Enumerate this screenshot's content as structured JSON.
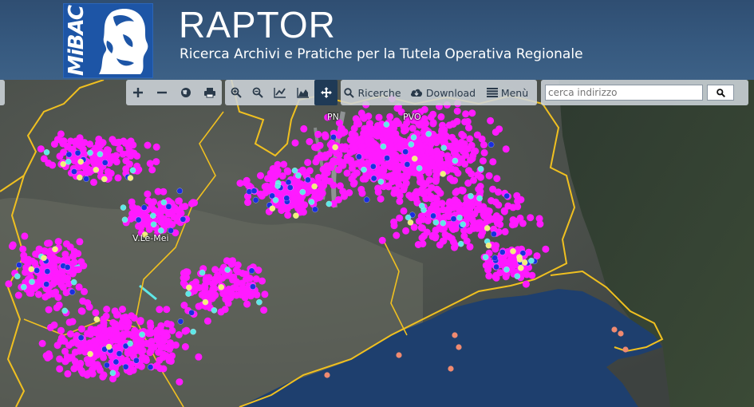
{
  "header": {
    "logo_text": "MiBAC",
    "title": "RAPTOR",
    "subtitle": "Ricerca Archivi e Pratiche per la Tutela Operativa Regionale"
  },
  "toolbar": {
    "nav_buttons": [
      {
        "name": "zoom-in-icon",
        "glyph": "+"
      },
      {
        "name": "zoom-out-icon",
        "glyph": "−"
      },
      {
        "name": "globe-icon"
      },
      {
        "name": "print-icon"
      }
    ],
    "tool_buttons": [
      {
        "name": "zoom-box-in-icon"
      },
      {
        "name": "zoom-box-out-icon"
      },
      {
        "name": "line-chart-icon"
      },
      {
        "name": "area-chart-icon"
      },
      {
        "name": "pan-icon",
        "active": true
      }
    ],
    "ricerche_label": "Ricerche",
    "download_label": "Download",
    "menu_label": "Menù",
    "search_placeholder": "cerca indirizzo"
  },
  "map": {
    "place_labels": [
      "PN",
      "PVO",
      "V.Le-Mei"
    ],
    "colors": {
      "border": "#f0c020",
      "point_main": "#ff1aff",
      "point_blue": "#1a2ee0",
      "point_cyan": "#5ee8e8",
      "point_yellow": "#f2f07a",
      "point_salmon": "#f08a70",
      "sea": "#1e3f6e"
    }
  }
}
